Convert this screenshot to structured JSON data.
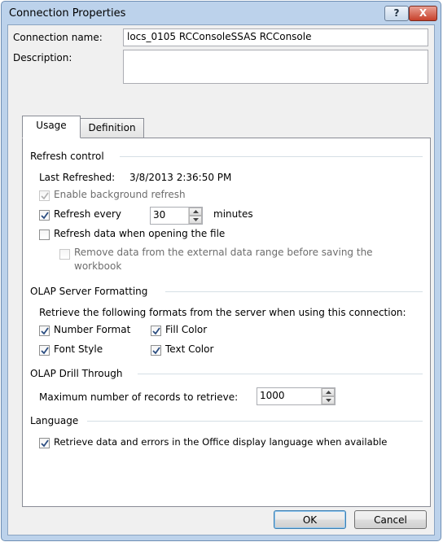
{
  "window": {
    "title": "Connection Properties",
    "help_label": "?",
    "close_label": "X"
  },
  "fields": {
    "name_label": "Connection name:",
    "name_value": "locs_0105 RCConsoleSSAS RCConsole",
    "description_label": "Description:",
    "description_value": ""
  },
  "tabs": [
    {
      "label": "Usage",
      "active": true
    },
    {
      "label": "Definition",
      "active": false
    }
  ],
  "refresh": {
    "group": "Refresh control",
    "last_refreshed_label": "Last Refreshed:",
    "last_refreshed_value": "3/8/2013  2:36:50 PM",
    "background_label": "Enable background refresh",
    "background_checked": true,
    "background_enabled": false,
    "every_label": "Refresh every",
    "every_checked": true,
    "every_value": "30",
    "every_unit": "minutes",
    "on_open_label": "Refresh data when opening the file",
    "on_open_checked": false,
    "remove_label_line1": "Remove data from the external data range before saving the",
    "remove_label_line2": "workbook",
    "remove_checked": false,
    "remove_enabled": false
  },
  "olap_format": {
    "group": "OLAP Server Formatting",
    "intro": "Retrieve the following formats from the server when using this connection:",
    "number_format": "Number Format",
    "fill_color": "Fill Color",
    "font_style": "Font Style",
    "text_color": "Text Color"
  },
  "drill": {
    "group": "OLAP Drill Through",
    "max_label": "Maximum number of records to retrieve:",
    "max_value": "1000"
  },
  "language": {
    "group": "Language",
    "retrieve_label": "Retrieve data and errors in the Office display language when available",
    "retrieve_checked": true
  },
  "buttons": {
    "ok": "OK",
    "cancel": "Cancel"
  }
}
